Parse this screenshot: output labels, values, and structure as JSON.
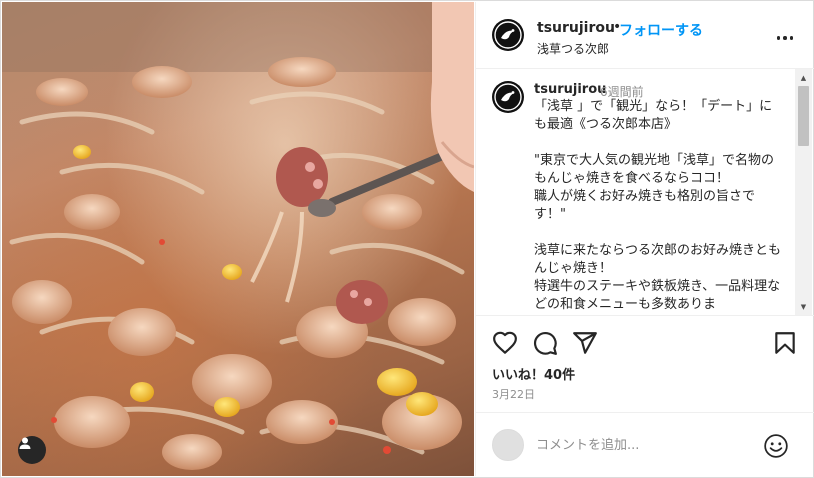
{
  "post": {
    "username": "tsurujirou",
    "separator": "•",
    "follow_label": "フォローする",
    "location": "浅草つる次郎",
    "more_icon": "more-horizontal-icon"
  },
  "caption": {
    "username": "tsurujirou",
    "time_ago": "6週間前",
    "text": "「浅草 」で「観光」なら！「デート」にも最適《つる次郎本店》\n\n\"東京で大人気の観光地「浅草」で名物のもんじゃ焼きを食べるならココ！\n職人が焼くお好み焼きも格別の旨さです！\"\n\n浅草に来たならつる次郎のお好み焼きともんじゃ焼き！\n特選牛のステーキや鉄板焼き、一品料理などの和食メニューも多数ありま"
  },
  "actions": {
    "icons": [
      "heart-icon",
      "comment-icon",
      "share-icon",
      "bookmark-icon"
    ],
    "likes": "いいね！40件",
    "date": "3月22日"
  },
  "comment_box": {
    "placeholder": "コメントを追加...",
    "emoji_icon": "emoji-icon"
  },
  "colors": {
    "accent": "#0095f6",
    "text": "#262626",
    "muted": "#8e8e8e",
    "border": "#dbdbdb"
  }
}
